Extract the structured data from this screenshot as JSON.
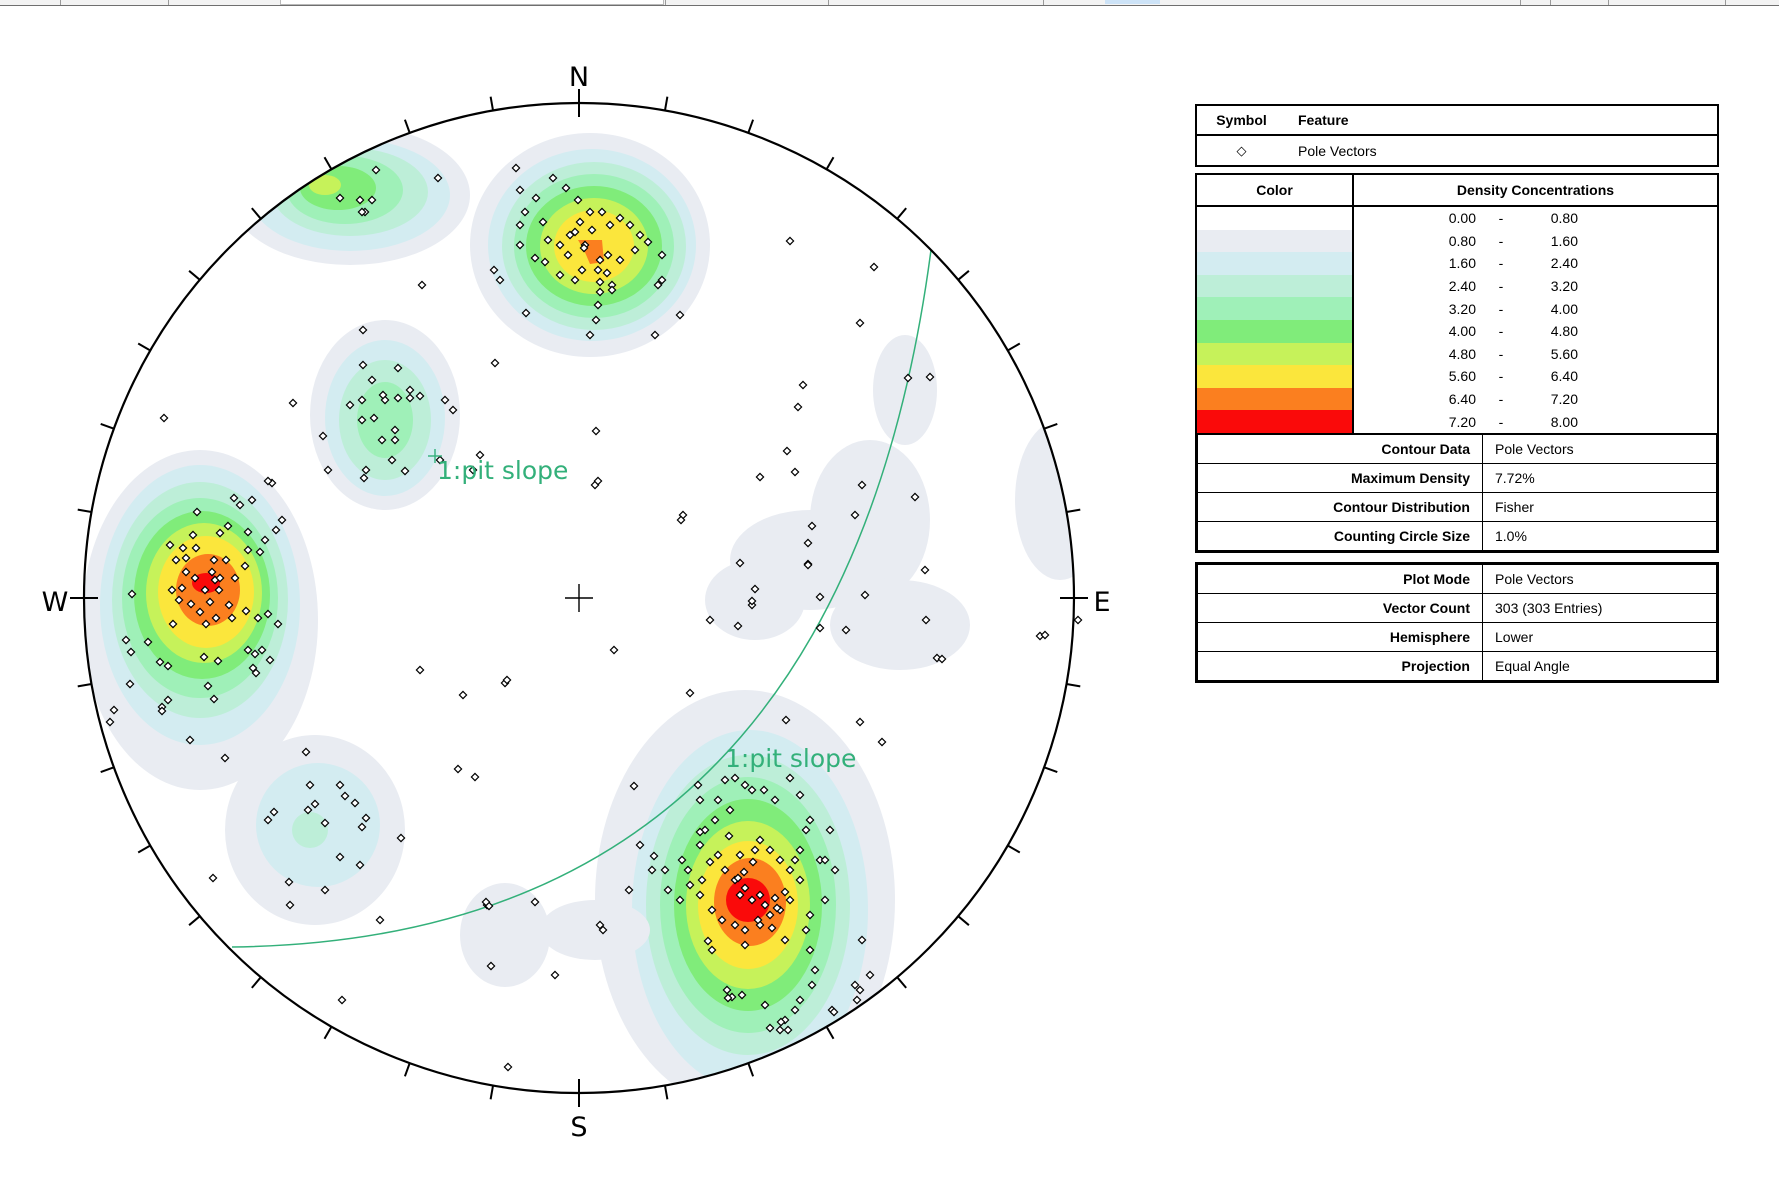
{
  "compass": {
    "north": "N",
    "south": "S",
    "east": "E",
    "west": "W"
  },
  "plane_labels": [
    {
      "id": "pole",
      "text": "1:pit slope"
    },
    {
      "id": "great-circle",
      "text": "1:pit slope"
    }
  ],
  "legend": {
    "symbol_header": {
      "symbol": "Symbol",
      "feature": "Feature"
    },
    "symbol_rows": [
      {
        "symbol": "◇",
        "feature": "Pole Vectors"
      }
    ],
    "density_header": {
      "color": "Color",
      "label": "Density Concentrations"
    },
    "density_ranges": [
      {
        "lo": "0.00",
        "hi": "0.80",
        "color": "#ffffff"
      },
      {
        "lo": "0.80",
        "hi": "1.60",
        "color": "#e9ecf2"
      },
      {
        "lo": "1.60",
        "hi": "2.40",
        "color": "#d3ecf1"
      },
      {
        "lo": "2.40",
        "hi": "3.20",
        "color": "#bdeed8"
      },
      {
        "lo": "3.20",
        "hi": "4.00",
        "color": "#9ff0b8"
      },
      {
        "lo": "4.00",
        "hi": "4.80",
        "color": "#80ec7a"
      },
      {
        "lo": "4.80",
        "hi": "5.60",
        "color": "#c6f25a"
      },
      {
        "lo": "5.60",
        "hi": "6.40",
        "color": "#fbe63c"
      },
      {
        "lo": "6.40",
        "hi": "7.20",
        "color": "#fb7f1f"
      },
      {
        "lo": "7.20",
        "hi": "8.00",
        "color": "#fa0a0a"
      }
    ],
    "range_separator": "-",
    "contour_info": [
      {
        "key": "Contour Data",
        "value": "Pole Vectors"
      },
      {
        "key": "Maximum Density",
        "value": "7.72%"
      },
      {
        "key": "Contour Distribution",
        "value": "Fisher"
      },
      {
        "key": "Counting Circle Size",
        "value": "1.0%"
      }
    ],
    "plot_info": [
      {
        "key": "Plot Mode",
        "value": "Pole Vectors"
      },
      {
        "key": "Vector Count",
        "value": "303 (303 Entries)"
      },
      {
        "key": "Hemisphere",
        "value": "Lower"
      },
      {
        "key": "Projection",
        "value": "Equal Angle"
      }
    ]
  },
  "colors": {
    "great_circle": "#33b07a",
    "pole_marker": "#000000"
  }
}
